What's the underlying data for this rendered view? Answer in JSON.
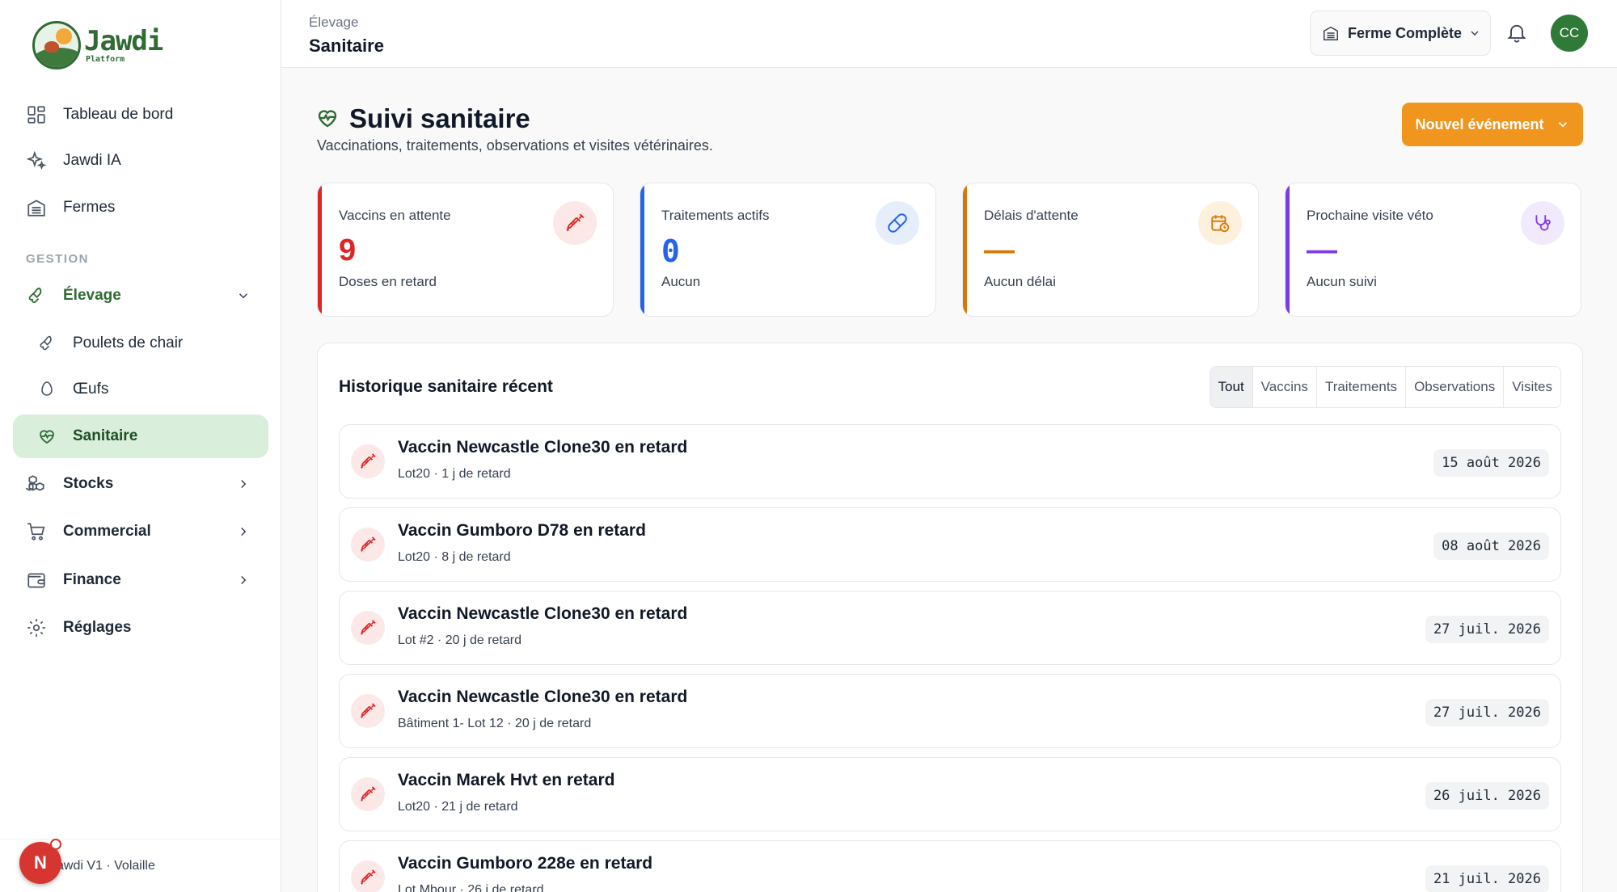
{
  "brand": {
    "name": "Jawdi",
    "tagline": "Platform"
  },
  "sidebar": {
    "section_label": "GESTION",
    "items": [
      {
        "label": "Tableau de bord"
      },
      {
        "label": "Jawdi IA"
      },
      {
        "label": "Fermes"
      },
      {
        "label": "Élevage"
      },
      {
        "label": "Poulets de chair"
      },
      {
        "label": "Œufs"
      },
      {
        "label": "Sanitaire"
      },
      {
        "label": "Stocks"
      },
      {
        "label": "Commercial"
      },
      {
        "label": "Finance"
      },
      {
        "label": "Réglages"
      }
    ],
    "footer": {
      "text": "Jawdi V1 · Volaille",
      "badge": "N"
    }
  },
  "topbar": {
    "breadcrumb": "Élevage",
    "title": "Sanitaire",
    "farm_selector": "Ferme Complète",
    "avatar": "CC"
  },
  "header": {
    "title": "Suivi sanitaire",
    "subtitle": "Vaccinations, traitements, observations et visites vétérinaires.",
    "new_button": "Nouvel événement"
  },
  "stats": [
    {
      "label": "Vaccins en attente",
      "value": "9",
      "sub": "Doses en retard",
      "icon": "syringe-icon",
      "color": "#dc2626"
    },
    {
      "label": "Traitements actifs",
      "value": "0",
      "sub": "Aucun",
      "icon": "pill-icon",
      "color": "#2563eb"
    },
    {
      "label": "Délais d'attente",
      "value": "—",
      "sub": "Aucun délai",
      "icon": "calendar-clock-icon",
      "color": "#d97706"
    },
    {
      "label": "Prochaine visite véto",
      "value": "—",
      "sub": "Aucun suivi",
      "icon": "stethoscope-icon",
      "color": "#7c3aed"
    }
  ],
  "history": {
    "title": "Historique sanitaire récent",
    "tabs": [
      "Tout",
      "Vaccins",
      "Traitements",
      "Observations",
      "Visites"
    ],
    "active_tab": "Tout",
    "rows": [
      {
        "title": "Vaccin Newcastle Clone30 en retard",
        "sub": "Lot20 · 1 j de retard",
        "date": "15 août 2026"
      },
      {
        "title": "Vaccin Gumboro D78 en retard",
        "sub": "Lot20 · 8 j de retard",
        "date": "08 août 2026"
      },
      {
        "title": "Vaccin Newcastle Clone30 en retard",
        "sub": "Lot #2 · 20 j de retard",
        "date": "27 juil. 2026"
      },
      {
        "title": "Vaccin Newcastle Clone30 en retard",
        "sub": "Bâtiment 1- Lot 12 · 20 j de retard",
        "date": "27 juil. 2026"
      },
      {
        "title": "Vaccin Marek Hvt en retard",
        "sub": "Lot20 · 21 j de retard",
        "date": "26 juil. 2026"
      },
      {
        "title": "Vaccin Gumboro 228e en retard",
        "sub": "Lot Mbour · 26 j de retard",
        "date": "21 juil. 2026"
      }
    ]
  },
  "colors": {
    "brand_green": "#2f6b33",
    "accent_orange": "#f0961f",
    "active_bg": "#d9eedb"
  }
}
